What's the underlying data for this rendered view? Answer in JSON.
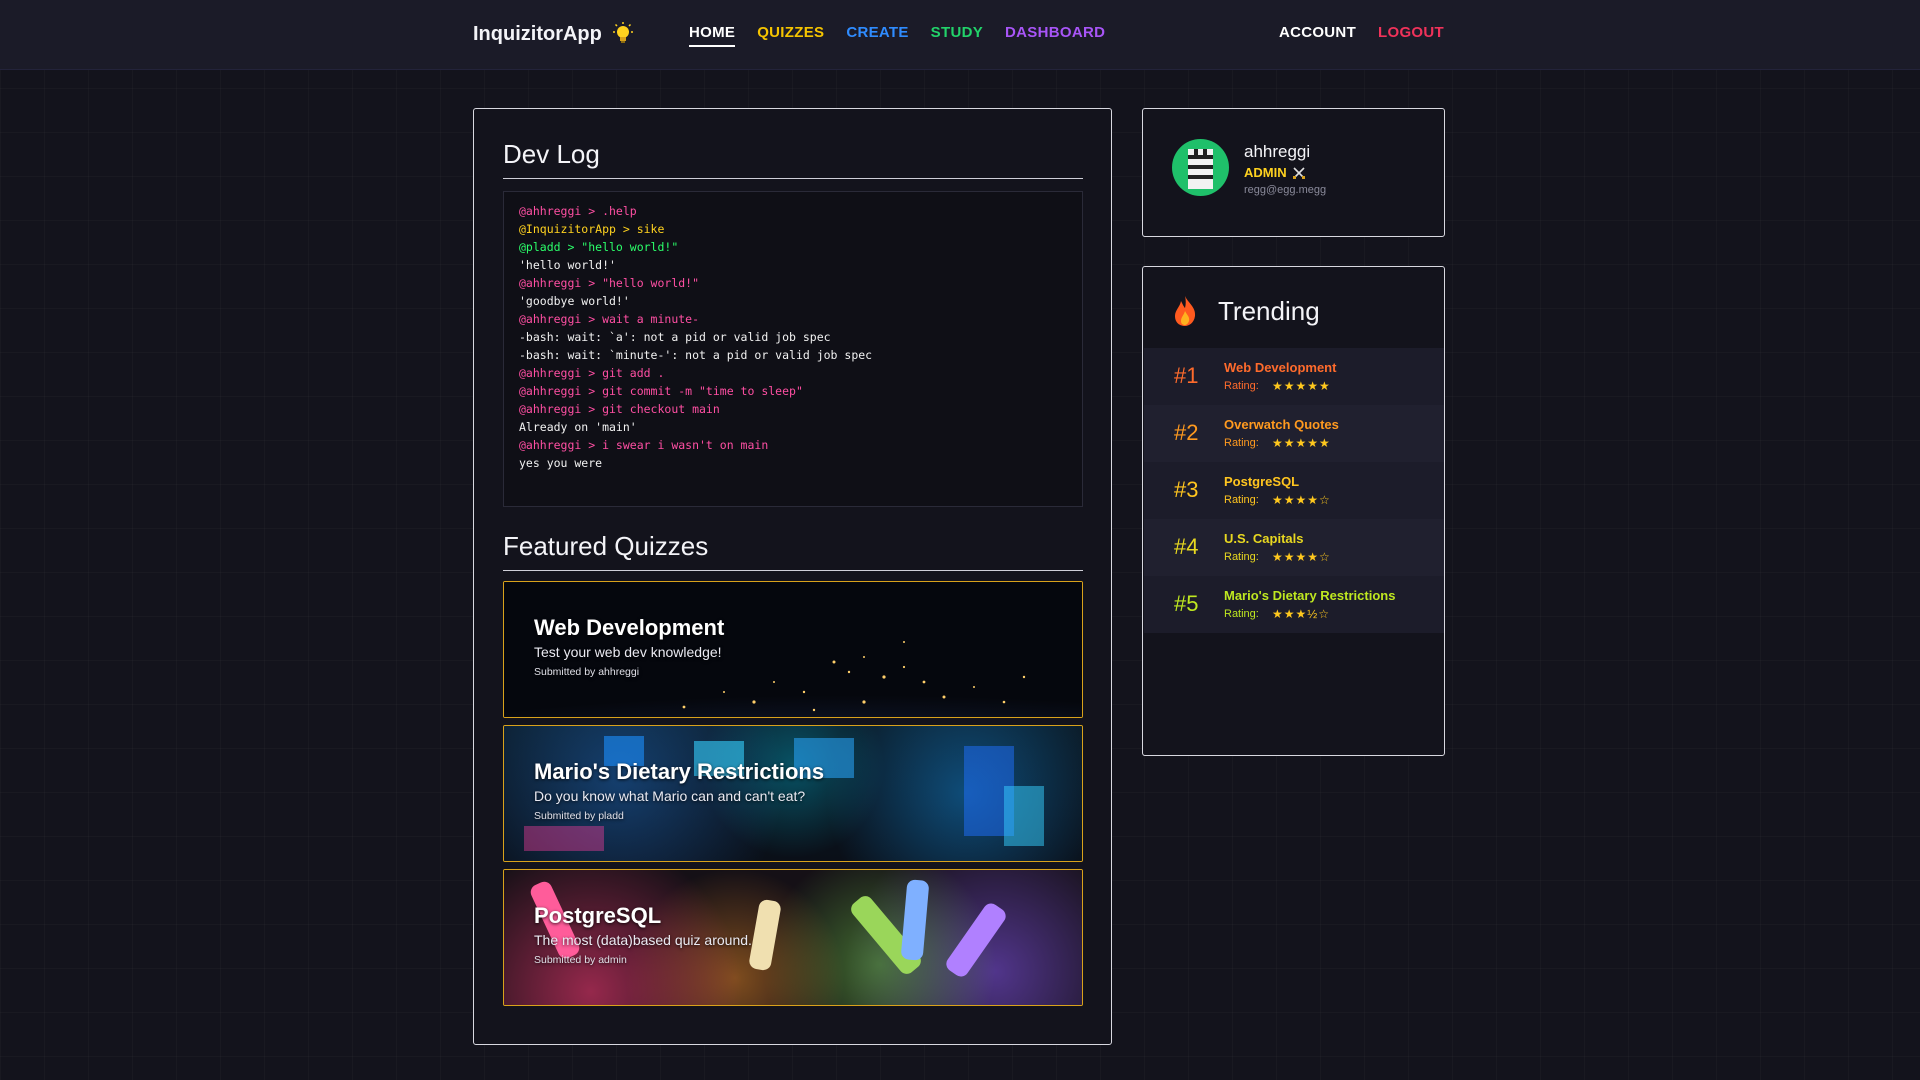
{
  "brand": {
    "name": "InquizitorApp",
    "icon": "lightbulb-icon"
  },
  "nav": {
    "home": "HOME",
    "quizzes": "QUIZZES",
    "create": "CREATE",
    "study": "STUDY",
    "dashboard": "DASHBOARD",
    "account": "ACCOUNT",
    "logout": "LOGOUT"
  },
  "devlog": {
    "title": "Dev Log",
    "lines": [
      {
        "text": "@ahhreggi > .help",
        "color": "pink"
      },
      {
        "text": "@InquizitorApp > sike",
        "color": "yellow"
      },
      {
        "text": "@pladd > \"hello world!\"",
        "color": "green"
      },
      {
        "text": "'hello world!'",
        "color": "white"
      },
      {
        "text": "@ahhreggi > \"hello world!\"",
        "color": "pink"
      },
      {
        "text": "'goodbye world!'",
        "color": "white"
      },
      {
        "text": "@ahhreggi > wait a minute-",
        "color": "pink"
      },
      {
        "text": "-bash: wait: `a': not a pid or valid job spec",
        "color": "white"
      },
      {
        "text": "-bash: wait: `minute-': not a pid or valid job spec",
        "color": "white"
      },
      {
        "text": "@ahhreggi > git add .",
        "color": "pink"
      },
      {
        "text": "@ahhreggi > git commit -m \"time to sleep\"",
        "color": "pink"
      },
      {
        "text": "@ahhreggi > git checkout main",
        "color": "pink"
      },
      {
        "text": "Already on 'main'",
        "color": "white"
      },
      {
        "text": "@ahhreggi > i swear i wasn't on main",
        "color": "pink"
      },
      {
        "text": "yes you were",
        "color": "white"
      }
    ]
  },
  "featured": {
    "title": "Featured Quizzes",
    "quizzes": [
      {
        "title": "Web Development",
        "description": "Test your web dev knowledge!",
        "submitted": "Submitted by ahhreggi"
      },
      {
        "title": "Mario's Dietary Restrictions",
        "description": "Do you know what Mario can and can't eat?",
        "submitted": "Submitted by pladd"
      },
      {
        "title": "PostgreSQL",
        "description": "The most (data)based quiz around.",
        "submitted": "Submitted by admin"
      }
    ]
  },
  "profile": {
    "username": "ahhreggi",
    "role": "ADMIN",
    "role_icon": "crossed-swords-icon",
    "email": "regg@egg.megg",
    "avatar_icon": "zebra-avatar-icon"
  },
  "trending": {
    "title": "Trending",
    "icon": "fire-icon",
    "rating_label": "Rating:",
    "items": [
      {
        "rank": "#1",
        "name": "Web Development",
        "stars": "★★★★★"
      },
      {
        "rank": "#2",
        "name": "Overwatch Quotes",
        "stars": "★★★★★"
      },
      {
        "rank": "#3",
        "name": "PostgreSQL",
        "stars": "★★★★☆"
      },
      {
        "rank": "#4",
        "name": "U.S. Capitals",
        "stars": "★★★★☆"
      },
      {
        "rank": "#5",
        "name": "Mario's Dietary Restrictions",
        "stars": "★★★½☆"
      }
    ]
  },
  "colors": {
    "accent_gold": "#d9a21b",
    "pink": "#ff4fa3",
    "yellow": "#ffd21f",
    "green": "#2bff6a"
  }
}
